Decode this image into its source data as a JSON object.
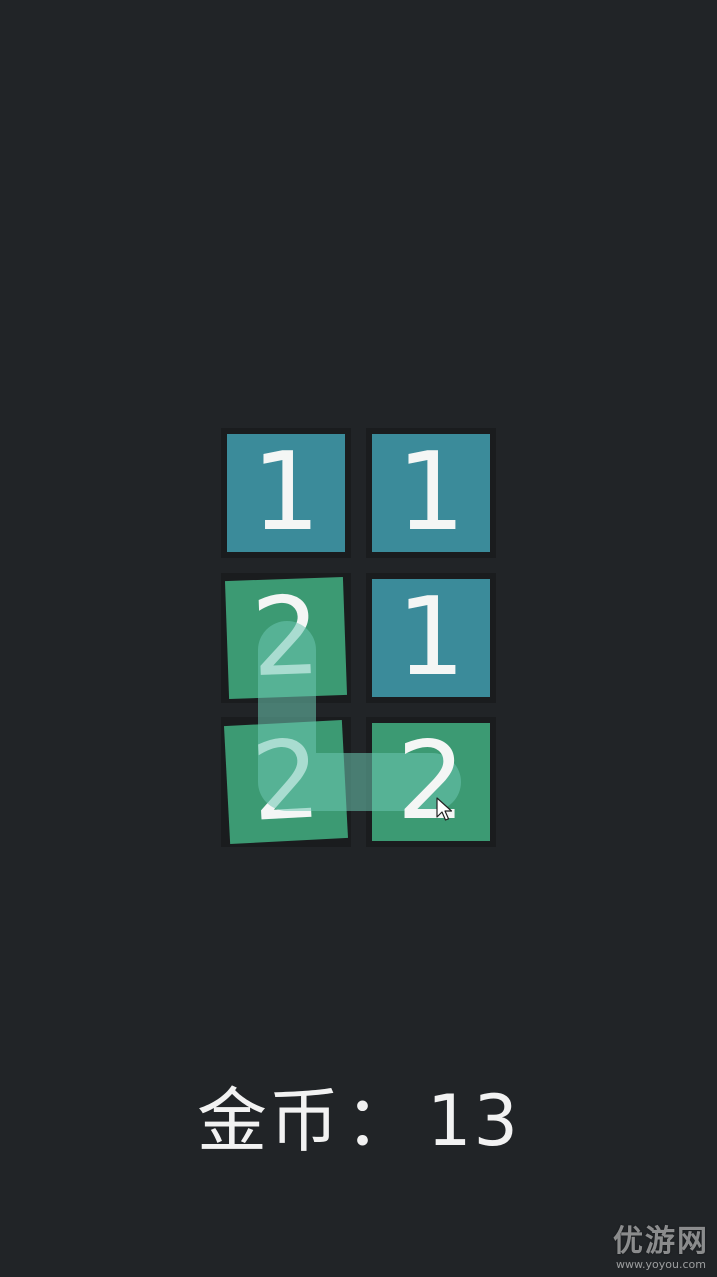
{
  "game": {
    "grid": [
      [
        {
          "value": "1",
          "color": "teal"
        },
        {
          "value": "1",
          "color": "teal"
        }
      ],
      [
        {
          "value": "2",
          "color": "green"
        },
        {
          "value": "1",
          "color": "teal"
        }
      ],
      [
        {
          "value": "2",
          "color": "green"
        },
        {
          "value": "2",
          "color": "green"
        }
      ]
    ],
    "colors": {
      "background": "#212427",
      "teal": "#3b8b9a",
      "green": "#3c9a73",
      "link": "#6cc7b0"
    }
  },
  "hud": {
    "coins_label": "金币",
    "coins_sep": "：",
    "coins_value": "13"
  },
  "watermark": {
    "main": "优游网",
    "url": "www.yoyou.com"
  }
}
